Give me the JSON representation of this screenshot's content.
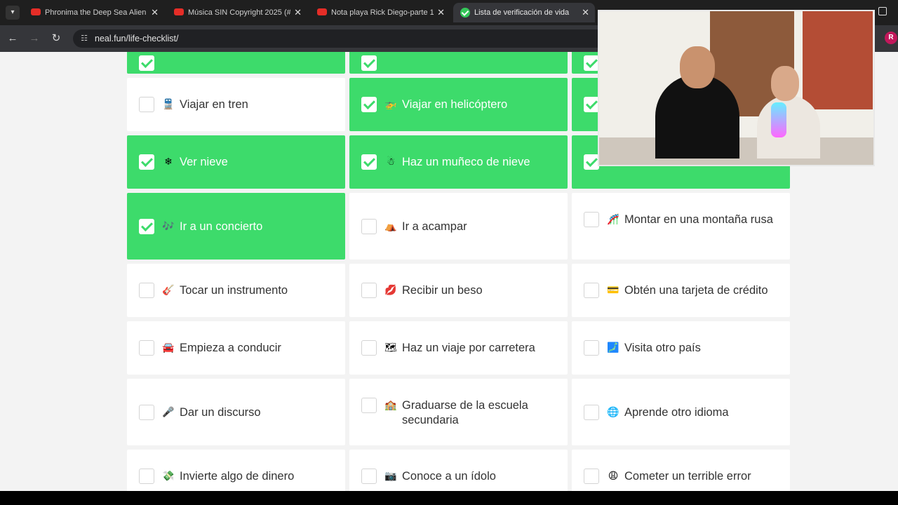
{
  "browser": {
    "tabs": [
      {
        "title": "Phronima the Deep Sea Alien |",
        "favicon": "youtube-icon",
        "active": false
      },
      {
        "title": "Música SIN Copyright 2025 (#2",
        "favicon": "youtube-icon",
        "active": false
      },
      {
        "title": "Nota playa Rick Diego-parte 1.",
        "favicon": "youtube-icon",
        "active": false
      },
      {
        "title": "Lista de verificación de vida",
        "favicon": "check-circle-icon",
        "active": true
      }
    ],
    "close_glyph": "✕",
    "url": "neal.fun/life-checklist/",
    "profile_initial": "R"
  },
  "colors": {
    "done": "#3ddb6b",
    "card": "#ffffff",
    "background": "#f3f3f3"
  },
  "checklist": {
    "rows": [
      [
        {
          "label": "",
          "emoji": "",
          "checked": true
        },
        {
          "label": "",
          "emoji": "",
          "checked": true
        },
        {
          "label": "",
          "emoji": "",
          "checked": true
        }
      ],
      [
        {
          "label": "Viajar en tren",
          "emoji": "🚆",
          "checked": false
        },
        {
          "label": "Viajar en helicóptero",
          "emoji": "🚁",
          "checked": true
        },
        {
          "label": "",
          "emoji": "",
          "checked": true
        }
      ],
      [
        {
          "label": "Ver nieve",
          "emoji": "❄",
          "checked": true
        },
        {
          "label": "Haz un muñeco de nieve",
          "emoji": "☃",
          "checked": true
        },
        {
          "label": "",
          "emoji": "",
          "checked": true
        }
      ],
      [
        {
          "label": "Ir a un concierto",
          "emoji": "🎶",
          "checked": true
        },
        {
          "label": "Ir a acampar",
          "emoji": "⛺",
          "checked": false
        },
        {
          "label": "Montar en una montaña rusa",
          "emoji": "🎢",
          "checked": false
        }
      ],
      [
        {
          "label": "Tocar un instrumento",
          "emoji": "🎸",
          "checked": false
        },
        {
          "label": "Recibir un beso",
          "emoji": "💋",
          "checked": false
        },
        {
          "label": "Obtén una tarjeta de crédito",
          "emoji": "💳",
          "checked": false
        }
      ],
      [
        {
          "label": "Empieza a conducir",
          "emoji": "🚘",
          "checked": false
        },
        {
          "label": "Haz un viaje por carretera",
          "emoji": "🗺",
          "checked": false
        },
        {
          "label": "Visita otro país",
          "emoji": "🗾",
          "checked": false
        }
      ],
      [
        {
          "label": "Dar un discurso",
          "emoji": "🎤",
          "checked": false
        },
        {
          "label": "Graduarse de la escuela secundaria",
          "emoji": "🏫",
          "checked": false
        },
        {
          "label": "Aprende otro idioma",
          "emoji": "🌐",
          "checked": false
        }
      ],
      [
        {
          "label": "Invierte algo de dinero",
          "emoji": "💸",
          "checked": false
        },
        {
          "label": "Conoce a un ídolo",
          "emoji": "📷",
          "checked": false
        },
        {
          "label": "Cometer un terrible error",
          "emoji": "😩",
          "checked": false
        }
      ]
    ]
  }
}
